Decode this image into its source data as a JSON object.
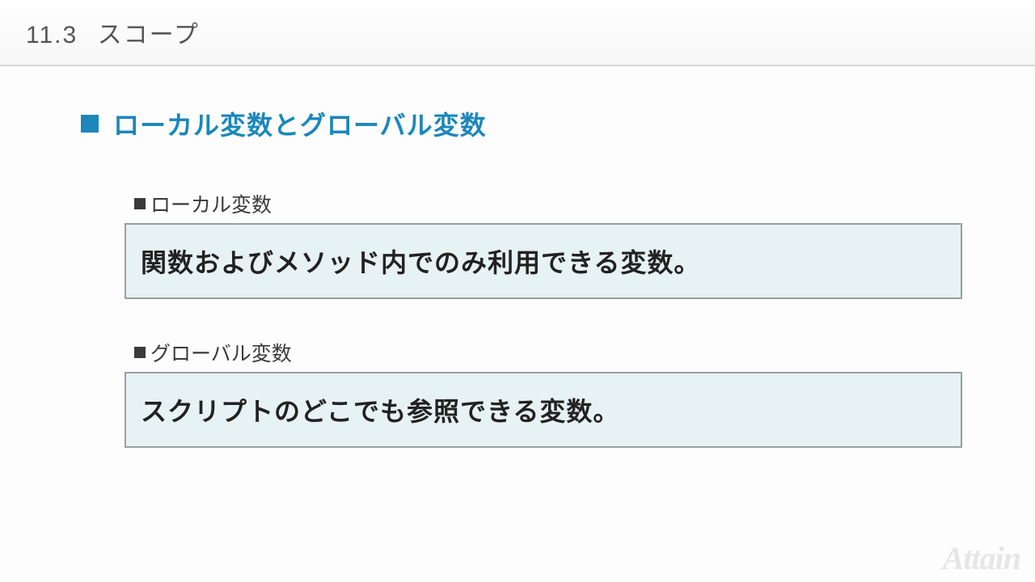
{
  "header": {
    "number": "11.3",
    "title": "スコープ"
  },
  "section": {
    "title": "ローカル変数とグローバル変数"
  },
  "subsections": [
    {
      "label": "ローカル変数",
      "definition": "関数およびメソッド内でのみ利用できる変数。"
    },
    {
      "label": "グローバル変数",
      "definition": "スクリプトのどこでも参照できる変数。"
    }
  ],
  "watermark": "Attain"
}
